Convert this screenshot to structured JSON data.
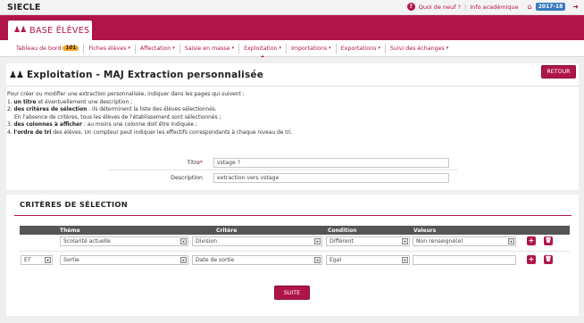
{
  "app": {
    "title": "SIECLE",
    "section": "BASE ÉLÈVES"
  },
  "topbar": {
    "news": "Quoi de neuf ?",
    "separator": "|",
    "academic_info": "Info académique",
    "year": "2017-18"
  },
  "nav": {
    "items": [
      {
        "label": "Tableau de bord",
        "badge": "101",
        "caret": ""
      },
      {
        "label": "Fiches élèves",
        "caret": "▾"
      },
      {
        "label": "Affectation",
        "caret": "▾"
      },
      {
        "label": "Saisie en masse",
        "caret": "▾"
      },
      {
        "label": "Exploitation",
        "caret": "▾"
      },
      {
        "label": "Importations",
        "caret": "▾"
      },
      {
        "label": "Exportations",
        "caret": "▾"
      },
      {
        "label": "Suivi des échanges",
        "caret": "▾"
      }
    ]
  },
  "page": {
    "title": "Exploitation - MAJ Extraction personnalisée",
    "retour": "RETOUR",
    "intro": {
      "line1": "Pour créer ou modifier une extraction personnalisée, indiquer dans les pages qui suivent :",
      "l2_num": "1.",
      "l2_bold": "un titre",
      "l2_rest": " et éventuellement une description ;",
      "l3_num": "2.",
      "l3_bold": "des critères de sélection",
      "l3_rest": " : ils déterminent la liste des élèves sélectionnés.",
      "line4": "En l'absence de critères, tous les élèves de l'établissement sont sélectionnés ;",
      "l5_num": "3.",
      "l5_bold": "des colonnes à afficher",
      "l5_rest": " : au moins une colonne doit être indiquée ;",
      "l6_num": "4.",
      "l6_bold": "l'ordre de tri",
      "l6_rest": " des élèves. Un compteur peut indiquer les effectifs correspondants à chaque niveau de tri."
    },
    "form": {
      "title_label": "Titre",
      "title_required": "*",
      "title_value": "vstage ?",
      "description_label": "Description",
      "description_value": "extraction vers vstage"
    }
  },
  "criteria": {
    "heading": "CRITÈRES DE SÉLECTION",
    "columns": {
      "theme": "Thème",
      "critere": "Critère",
      "condition": "Condition",
      "valeurs": "Valeurs"
    },
    "rows": [
      {
        "connector": "",
        "theme": "Scolarité actuelle",
        "critere": "Division",
        "condition": "Différent",
        "valeur": "Non renseigné(e)"
      },
      {
        "connector": "ET",
        "theme": "Sortie",
        "critere": "Date de sortie",
        "condition": "Egal",
        "valeur": ""
      }
    ],
    "add_symbol": "+",
    "delete_symbol": "🗑",
    "arrow": "▾"
  },
  "actions": {
    "suite": "SUITE"
  },
  "colors": {
    "accent": "#b0154a",
    "year_badge": "#3a7bbf",
    "nav_badge": "#f5a623",
    "table_header": "#555555"
  }
}
